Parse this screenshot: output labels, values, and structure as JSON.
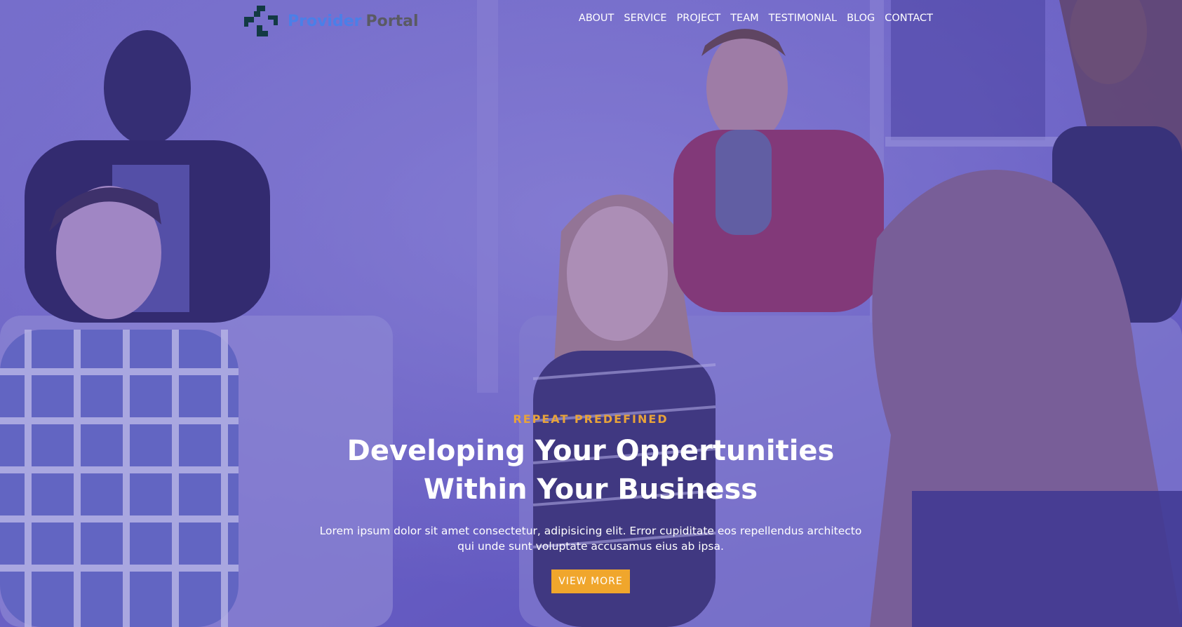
{
  "brand": {
    "name_part1": "Provider",
    "name_part2": "Portal",
    "logo_icon": "provider-cross-logo"
  },
  "nav": {
    "items": [
      {
        "label": "ABOUT"
      },
      {
        "label": "SERVICE"
      },
      {
        "label": "PROJECT"
      },
      {
        "label": "TEAM"
      },
      {
        "label": "TESTIMONIAL"
      },
      {
        "label": "BLOG"
      },
      {
        "label": "CONTACT"
      }
    ]
  },
  "hero": {
    "eyebrow": "REPEAT PREDEFINED",
    "title": "Developing Your Oppertunities Within Your Business",
    "text": "Lorem ipsum dolor sit amet consectetur, adipisicing elit. Error cupiditate eos repellendus architecto qui unde sunt voluptate accusamus eius ab ipsa.",
    "cta_label": "VIEW MORE"
  },
  "colors": {
    "overlay": "#5a4fc4",
    "accent": "#f0a62c",
    "brand_blue": "#4b7fe8",
    "brand_gray": "#5a5a63"
  }
}
